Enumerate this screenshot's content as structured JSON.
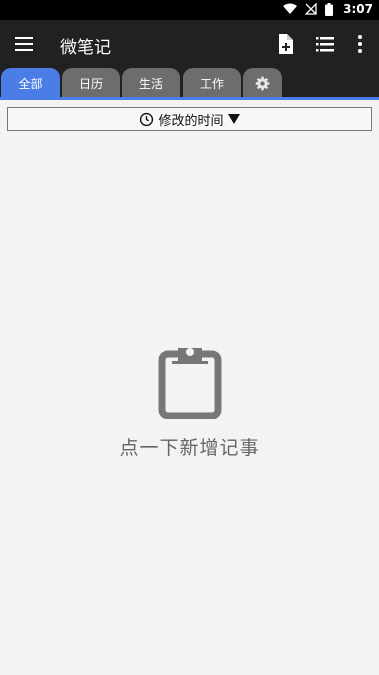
{
  "status_bar": {
    "time": "3:07"
  },
  "app_bar": {
    "title": "微笔记"
  },
  "tabs": [
    {
      "label": "全部",
      "active": true
    },
    {
      "label": "日历",
      "active": false
    },
    {
      "label": "生活",
      "active": false
    },
    {
      "label": "工作",
      "active": false
    }
  ],
  "sort": {
    "label": "修改的时间"
  },
  "empty_state": {
    "message": "点一下新增记事"
  },
  "colors": {
    "accent": "#4a7de6",
    "toolbar": "#212121",
    "tab_inactive": "#6d6d6d",
    "background": "#f3f3f3"
  }
}
